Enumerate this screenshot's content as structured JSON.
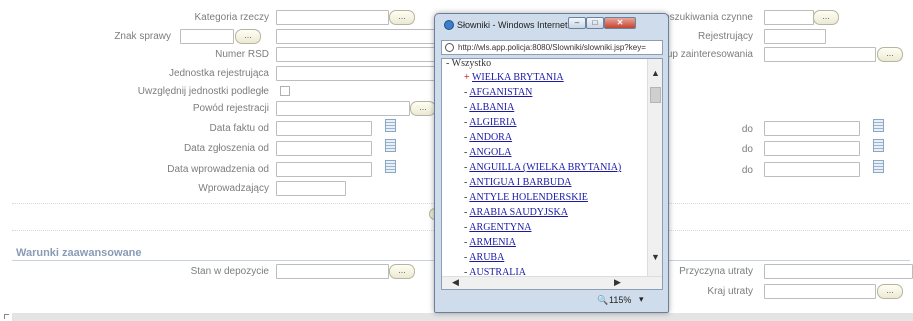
{
  "form": {
    "left_labels": [
      "Kategoria rzeczy",
      "Znak sprawy",
      "Numer RSD",
      "Jednostka rejestrująca",
      "Uwzględnij jednostki podległe",
      "Powód rejestracji",
      "Data faktu od",
      "Data zgłoszenia od",
      "Data wprowadzenia od",
      "Wprowadzający"
    ],
    "right_labels": {
      "poszukiwania": "Poszukiwania czynne",
      "rejestrujacy": "Rejestrujący",
      "zainteresowania": "Grup zainteresowania",
      "do1": "do",
      "do2": "do",
      "do3": "do"
    },
    "dots_label": "...",
    "section_title": "Warunki zaawansowane",
    "advanced": {
      "stan": "Stan w depozycie",
      "przyczyna": "Przyczyna utraty",
      "kraj": "Kraj utraty"
    },
    "colors": {
      "section": "#8a9bb4",
      "link": "#1a1aa6"
    }
  },
  "popup": {
    "title": "Słowniki - Windows Internet Expl...",
    "url": "http://wls.app.policja:8080/Slowniki/slowniki.jsp?key=",
    "root": "- Wszystko",
    "items": [
      {
        "bullet": "+",
        "label": "WIELKA BRYTANIA"
      },
      {
        "bullet": "-",
        "label": "AFGANISTAN"
      },
      {
        "bullet": "-",
        "label": "ALBANIA"
      },
      {
        "bullet": "-",
        "label": "ALGIERIA"
      },
      {
        "bullet": "-",
        "label": "ANDORA"
      },
      {
        "bullet": "-",
        "label": "ANGOLA"
      },
      {
        "bullet": "-",
        "label": "ANGUILLA (WIELKA BRYTANIA)"
      },
      {
        "bullet": "-",
        "label": "ANTIGUA I BARBUDA"
      },
      {
        "bullet": "-",
        "label": "ANTYLE HOLENDERSKIE"
      },
      {
        "bullet": "-",
        "label": "ARABIA SAUDYJSKA"
      },
      {
        "bullet": "-",
        "label": "ARGENTYNA"
      },
      {
        "bullet": "-",
        "label": "ARMENIA"
      },
      {
        "bullet": "-",
        "label": "ARUBA"
      },
      {
        "bullet": "-",
        "label": "AUSTRALIA"
      }
    ],
    "zoom": "115%"
  }
}
